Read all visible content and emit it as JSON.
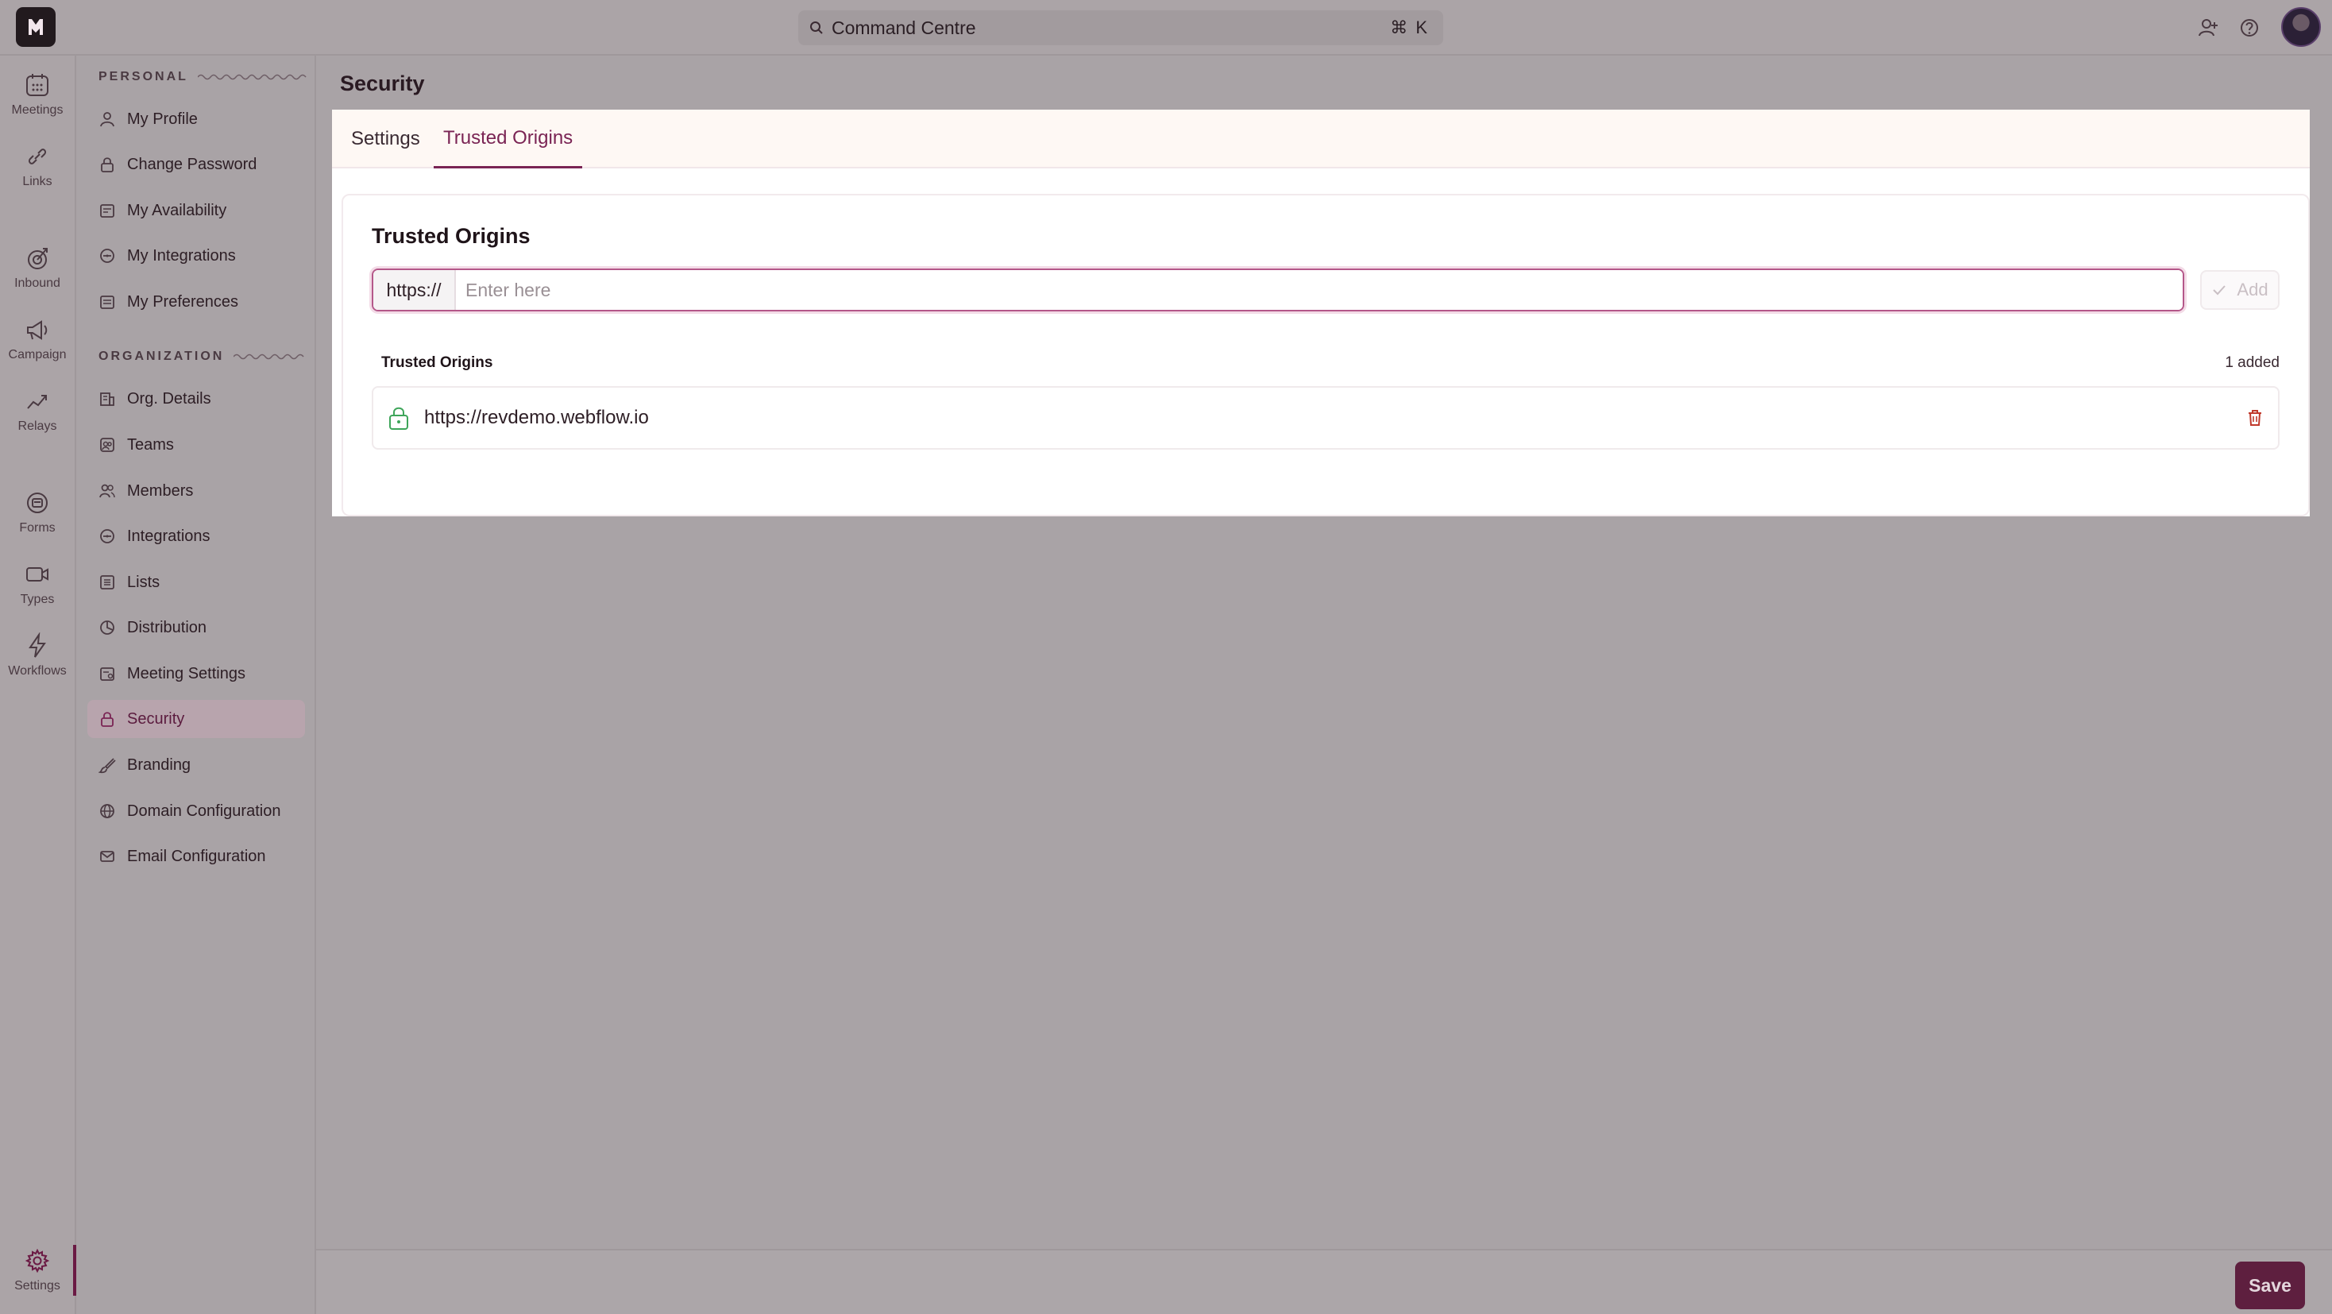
{
  "topbar": {
    "command_label": "Command Centre",
    "command_shortcut": "⌘ K"
  },
  "rail": {
    "items": [
      {
        "label": "Meetings",
        "icon": "calendar-icon"
      },
      {
        "label": "Links",
        "icon": "link-icon"
      },
      {
        "label": "Inbound",
        "icon": "inbound-icon"
      },
      {
        "label": "Campaign",
        "icon": "megaphone-icon"
      },
      {
        "label": "Relays",
        "icon": "relay-icon"
      },
      {
        "label": "Forms",
        "icon": "form-icon"
      },
      {
        "label": "Types",
        "icon": "video-icon"
      },
      {
        "label": "Workflows",
        "icon": "lightning-icon"
      },
      {
        "label": "Settings",
        "icon": "gear-icon"
      }
    ]
  },
  "sidebar": {
    "personal_heading": "PERSONAL",
    "organization_heading": "ORGANIZATION",
    "personal_items": [
      {
        "label": "My Profile"
      },
      {
        "label": "Change Password"
      },
      {
        "label": "My Availability"
      },
      {
        "label": "My Integrations"
      },
      {
        "label": "My Preferences"
      }
    ],
    "org_items": [
      {
        "label": "Org. Details"
      },
      {
        "label": "Teams"
      },
      {
        "label": "Members"
      },
      {
        "label": "Integrations"
      },
      {
        "label": "Lists"
      },
      {
        "label": "Distribution"
      },
      {
        "label": "Meeting Settings"
      },
      {
        "label": "Security"
      },
      {
        "label": "Branding"
      },
      {
        "label": "Domain Configuration"
      },
      {
        "label": "Email Configuration"
      }
    ],
    "active": "Security"
  },
  "main": {
    "page_title": "Security",
    "tabs": [
      {
        "label": "Settings"
      },
      {
        "label": "Trusted Origins"
      }
    ],
    "active_tab": "Trusted Origins",
    "card_title": "Trusted Origins",
    "input_prefix": "https://",
    "input_placeholder": "Enter here",
    "input_value": "",
    "add_label": "Add",
    "list_heading": "Trusted Origins",
    "list_count": "1 added",
    "origins": [
      {
        "url": "https://revdemo.webflow.io"
      }
    ]
  },
  "footer": {
    "save_label": "Save"
  },
  "colors": {
    "accent": "#7a2454",
    "save_bg": "#5e1f3f",
    "lock_green": "#3ea55a",
    "trash_red": "#c0392b"
  }
}
